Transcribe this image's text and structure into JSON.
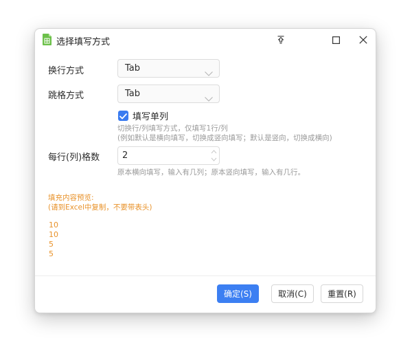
{
  "dialog": {
    "title": "选择填写方式",
    "controls": [
      "pin-icon",
      "maximize-icon",
      "close-icon"
    ]
  },
  "form": {
    "wrap_label": "换行方式",
    "wrap_value": "Tab",
    "jump_label": "跳格方式",
    "jump_value": "Tab",
    "single_column_label": "填写单列",
    "single_column_checked": true,
    "single_column_hint1": "切换行/列填写方式，仅填写1行/列",
    "single_column_hint2": "(例如默认是横向填写，切换成竖向填写；默认是竖向，切换成横向)",
    "cells_label": "每行(列)格数",
    "cells_value": "2",
    "cells_hint": "原本横向填写，输入有几列；原本竖向填写，输入有几行。"
  },
  "preview": {
    "title": "填充内容预览:",
    "note": "(请到Excel中复制，不要带表头)",
    "values": [
      "10",
      "10",
      "5",
      "5"
    ],
    "color": "#e8922a"
  },
  "buttons": {
    "ok": "确定(S)",
    "cancel": "取消(C)",
    "reset": "重置(R)"
  },
  "colors": {
    "accent": "#3c7ff2",
    "app_icon": "#6cc04a"
  }
}
